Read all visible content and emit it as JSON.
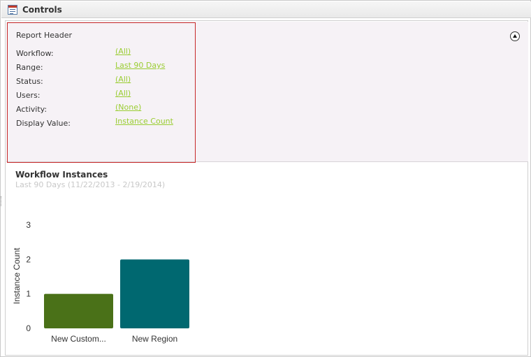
{
  "window": {
    "title": "Controls",
    "icon": "report-grid-icon"
  },
  "report_header": {
    "label": "Report Header",
    "params": [
      {
        "label": "Workflow:",
        "value": "(All)"
      },
      {
        "label": "Range:",
        "value": "Last 90 Days"
      },
      {
        "label": "Status:",
        "value": "(All)"
      },
      {
        "label": "Users:",
        "value": "(All)"
      },
      {
        "label": "Activity:",
        "value": "(None)"
      },
      {
        "label": "Display Value:",
        "value": "Instance Count"
      }
    ],
    "collapse_icon": "chevron-up-circle-icon"
  },
  "chart": {
    "title": "Workflow Instances",
    "subtitle": "Last 90 Days (11/22/2013 - 2/19/2014)"
  },
  "chart_data": {
    "type": "bar",
    "categories": [
      "New Custom...",
      "New Region"
    ],
    "values": [
      1,
      2
    ],
    "colors": [
      "#4a7118",
      "#006870"
    ],
    "title": "Workflow Instances",
    "subtitle": "Last 90 Days (11/22/2013 - 2/19/2014)",
    "xlabel": "",
    "ylabel": "Instance Count",
    "ylim": [
      0,
      3
    ],
    "yticks": [
      0,
      1,
      2,
      3
    ],
    "grid": false,
    "legend": "none"
  }
}
